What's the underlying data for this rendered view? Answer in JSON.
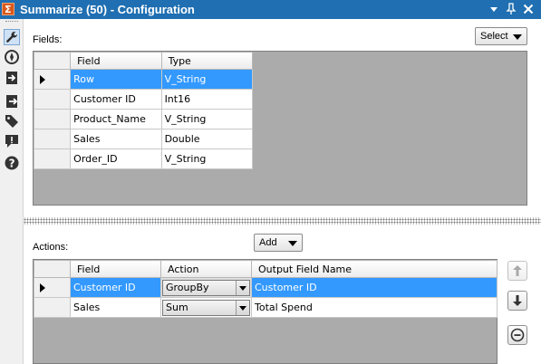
{
  "window": {
    "title": "Summarize (50) - Configuration",
    "controls": {
      "dropdown_glyph": "▾",
      "pin_glyph": "📌",
      "close_glyph": "✕"
    }
  },
  "left_toolbar": {
    "items": [
      {
        "name": "wrench-icon",
        "active": true
      },
      {
        "name": "compass-icon",
        "active": false
      },
      {
        "name": "input-arrow-icon",
        "active": false
      },
      {
        "name": "output-arrow-icon",
        "active": false
      },
      {
        "name": "tag-icon",
        "active": false
      },
      {
        "name": "alert-icon",
        "active": false
      },
      {
        "name": "help-icon",
        "active": false
      }
    ]
  },
  "fields_section": {
    "label": "Fields:",
    "select_button": "Select",
    "columns": [
      "Field",
      "Type"
    ],
    "rows": [
      {
        "field": "Row",
        "type": "V_String",
        "selected": true
      },
      {
        "field": "Customer ID",
        "type": "Int16",
        "selected": false
      },
      {
        "field": "Product_Name",
        "type": "V_String",
        "selected": false
      },
      {
        "field": "Sales",
        "type": "Double",
        "selected": false
      },
      {
        "field": "Order_ID",
        "type": "V_String",
        "selected": false
      }
    ]
  },
  "actions_section": {
    "label": "Actions:",
    "add_button": "Add",
    "columns": [
      "Field",
      "Action",
      "Output Field Name"
    ],
    "rows": [
      {
        "field": "Customer ID",
        "action": "GroupBy",
        "output": "Customer ID",
        "selected": true
      },
      {
        "field": "Sales",
        "action": "Sum",
        "output": "Total Spend",
        "selected": false
      }
    ],
    "side_buttons": [
      "move-up-icon",
      "move-down-icon",
      "remove-icon"
    ]
  },
  "colors": {
    "titlebar": "#1f6fb2",
    "selection": "#3399ff",
    "grid_background": "#ababab"
  }
}
